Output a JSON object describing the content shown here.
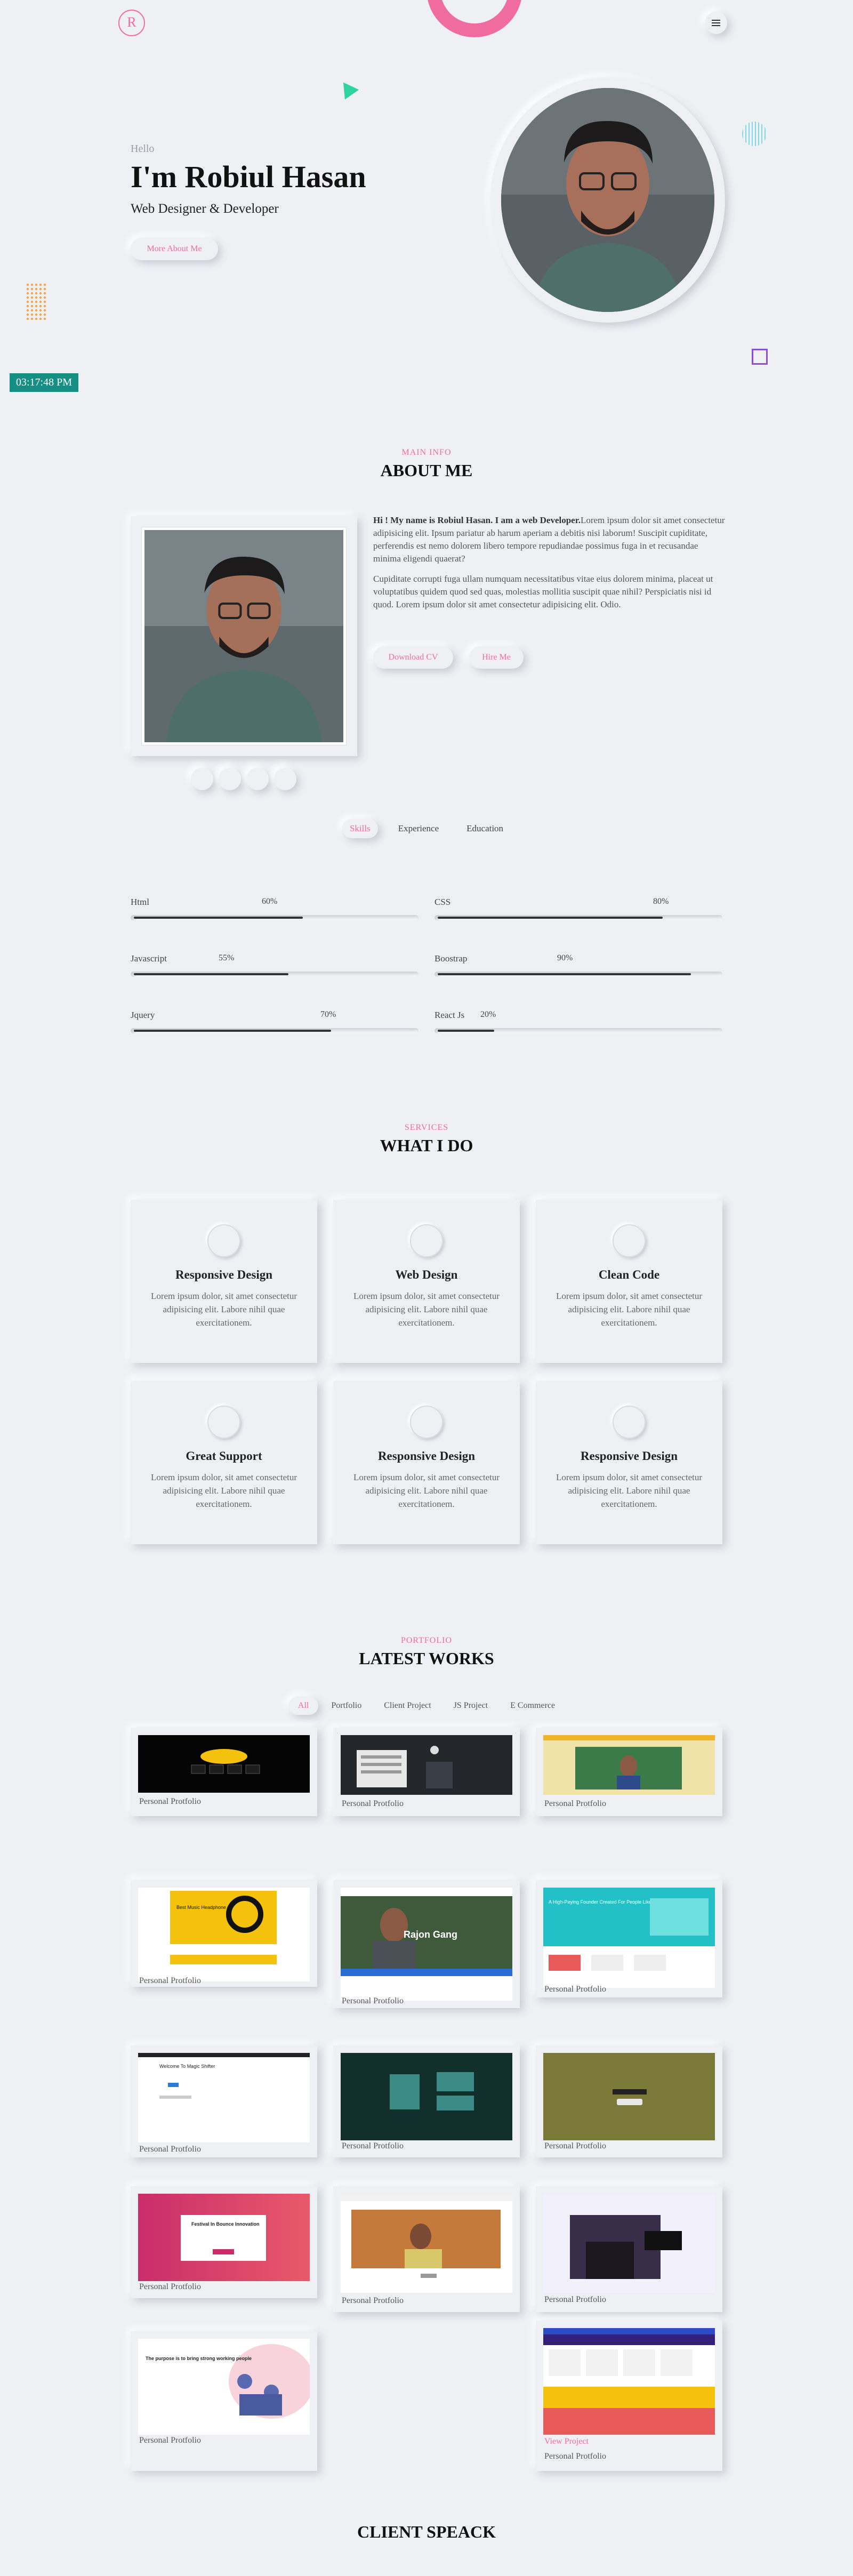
{
  "header": {
    "logo": "R",
    "menu_icon": "hamburger-icon"
  },
  "hero": {
    "greeting": "Hello",
    "name": "I'm Robiul Hasan",
    "role": "Web Designer & Developer",
    "more_button": "More About Me",
    "clock": "03:17:48 PM"
  },
  "about": {
    "subtitle": "MAIN INFO",
    "title": "ABOUT ME",
    "intro_bold": "Hi ! My name is Robiul Hasan. I am a web Developer.",
    "intro_rest": "Lorem ipsum dolor sit amet consectetur adipisicing elit. Ipsum pariatur ab harum aperiam a debitis nisi laborum! Suscipit cupiditate, perferendis est nemo dolorem libero tempore repudiandae possimus fuga in et recusandae minima eligendi quaerat?",
    "paragraph2": "Cupiditate corrupti fuga ullam numquam necessitatibus vitae eius dolorem minima, placeat ut voluptatibus quidem quod sed quas, molestias mollitia suscipit quae nihil? Perspiciatis nisi id quod. Lorem ipsum dolor sit amet consectetur adipisicing elit. Odio.",
    "download_cv": "Download CV",
    "hire_me": "Hire Me",
    "social": [
      "facebook-icon",
      "twitter-icon",
      "linkedin-icon",
      "github-icon"
    ]
  },
  "skills_tabs": [
    "Skills",
    "Experience",
    "Education"
  ],
  "skills": [
    {
      "name": "Html",
      "percent": "60%",
      "value": 0.6
    },
    {
      "name": "CSS",
      "percent": "80%",
      "value": 0.8
    },
    {
      "name": "Javascript",
      "percent": "55%",
      "value": 0.55
    },
    {
      "name": "Boostrap",
      "percent": "90%",
      "value": 0.9
    },
    {
      "name": "Jquery",
      "percent": "70%",
      "value": 0.7
    },
    {
      "name": "React Js",
      "percent": "20%",
      "value": 0.2
    }
  ],
  "services": {
    "subtitle": "SERVICES",
    "title": "WHAT I DO",
    "items": [
      {
        "title": "Responsive Design",
        "text": "Lorem ipsum dolor, sit amet consectetur adipisicing elit. Labore nihil quae exercitationem."
      },
      {
        "title": "Web Design",
        "text": "Lorem ipsum dolor, sit amet consectetur adipisicing elit. Labore nihil quae exercitationem."
      },
      {
        "title": "Clean Code",
        "text": "Lorem ipsum dolor, sit amet consectetur adipisicing elit. Labore nihil quae exercitationem."
      },
      {
        "title": "Great Support",
        "text": "Lorem ipsum dolor, sit amet consectetur adipisicing elit. Labore nihil quae exercitationem."
      },
      {
        "title": "Responsive Design",
        "text": "Lorem ipsum dolor, sit amet consectetur adipisicing elit. Labore nihil quae exercitationem."
      },
      {
        "title": "Responsive Design",
        "text": "Lorem ipsum dolor, sit amet consectetur adipisicing elit. Labore nihil quae exercitationem."
      }
    ]
  },
  "portfolio": {
    "subtitle": "PORTFOLIO",
    "title": "LATEST WORKS",
    "filters": [
      "All",
      "Portfolio",
      "Client Project",
      "JS Project",
      "E Commerce"
    ],
    "item_caption": "Personal Protfolio",
    "view_project": "View Project",
    "thumb_texts": {
      "rajon": "Rajon Gang",
      "hero_ceo": "A High-Paying Founder Created For People Like You",
      "resale": "Welcome To Magic Shifter",
      "festival": "Festival In Bounce Innovation",
      "headphone": "Best Music Headphone",
      "good_people": "The purpose is to bring strong working people"
    }
  },
  "client": {
    "title": "CLIENT SPEACK"
  }
}
